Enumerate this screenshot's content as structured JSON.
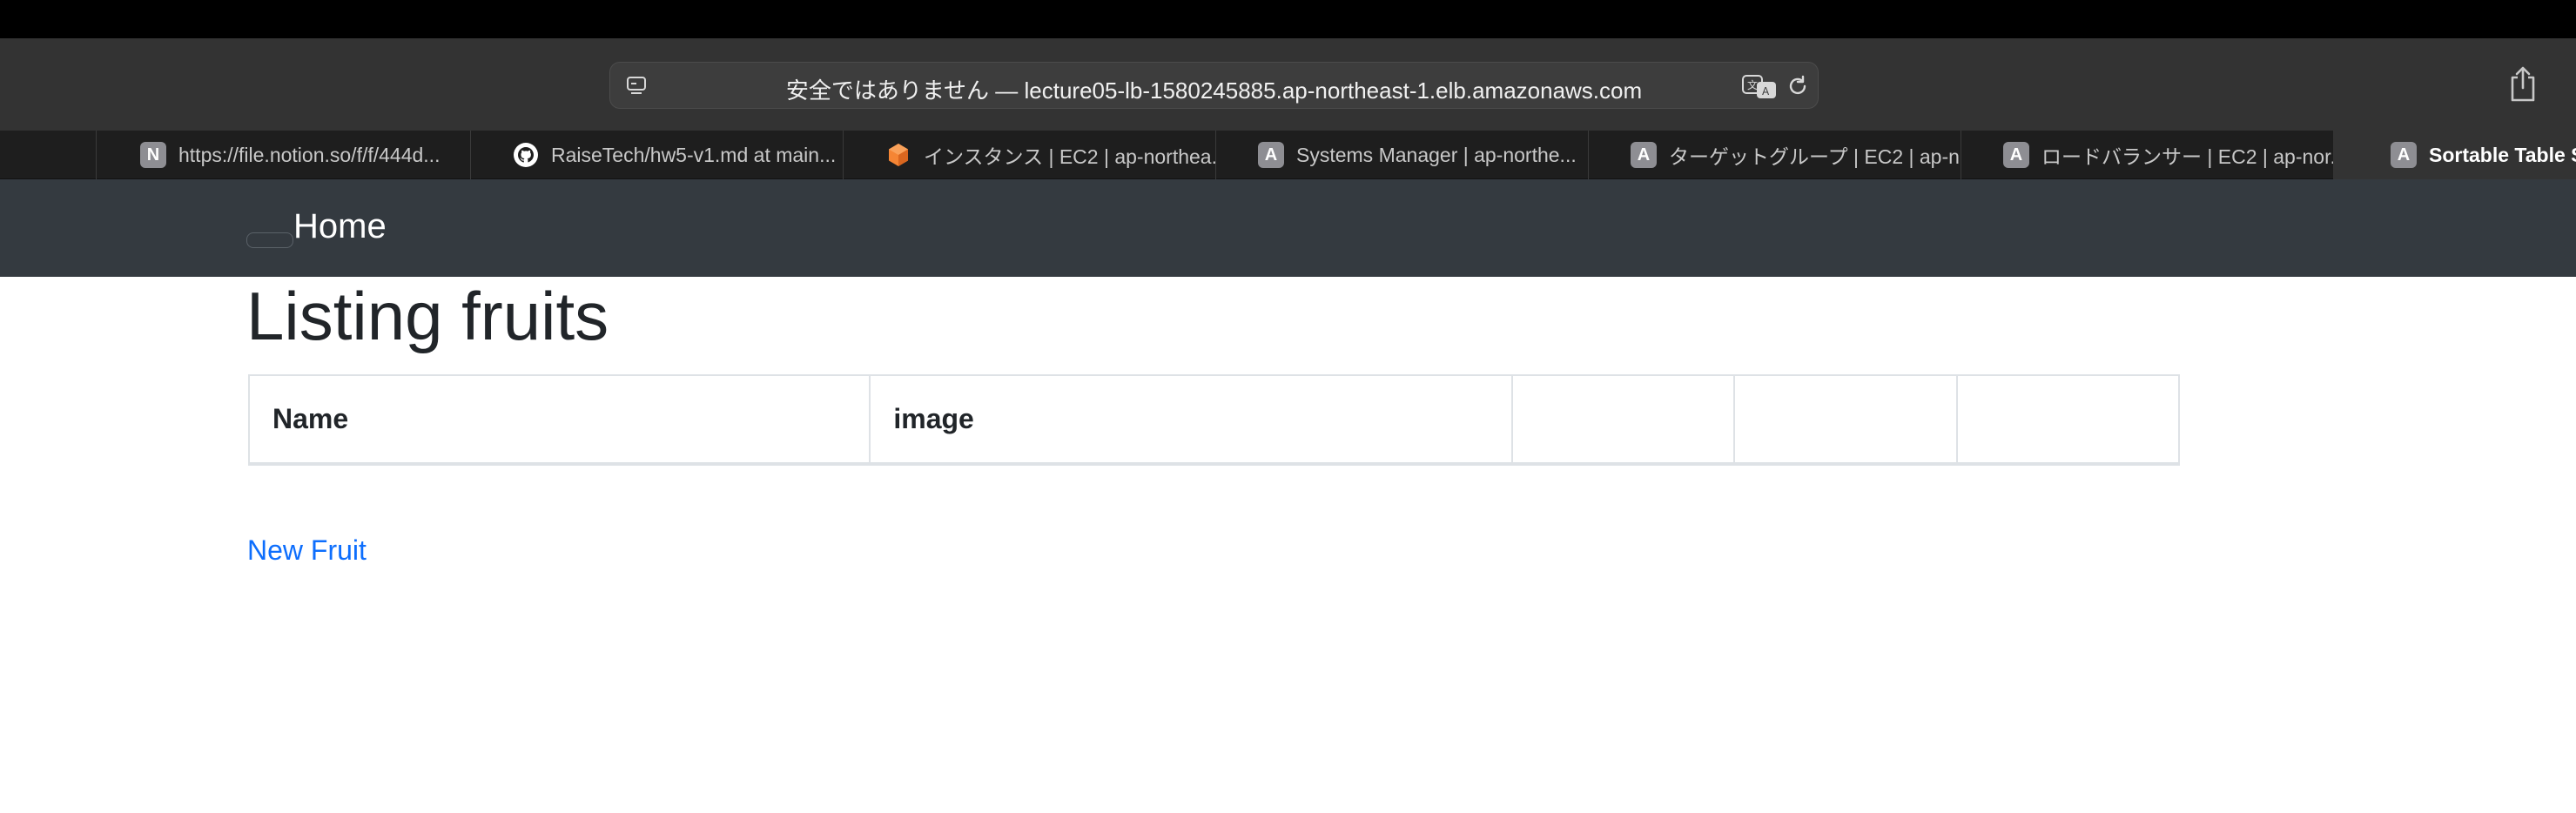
{
  "browser": {
    "address": "安全ではありません — lecture05-lb-1580245885.ap-northeast-1.elb.amazonaws.com",
    "icons": {
      "reader": "reader-icon",
      "translate": "translate-icon",
      "reload": "reload-icon",
      "share": "share-icon"
    }
  },
  "tabs": [
    {
      "label": "https://file.notion.so/f/f/444d...",
      "icon": "notion-icon",
      "favicon_text": "N"
    },
    {
      "label": "RaiseTech/hw5-v1.md at main...",
      "icon": "github-icon"
    },
    {
      "label": "インスタンス | EC2 | ap-northea...",
      "icon": "aws-ec2-icon"
    },
    {
      "label": "Systems Manager | ap-northe...",
      "icon": "generic-site-icon",
      "favicon_text": "A"
    },
    {
      "label": "ターゲットグループ | EC2 | ap-n...",
      "icon": "generic-site-icon",
      "favicon_text": "A"
    },
    {
      "label": "ロードバランサー | EC2 | ap-nor...",
      "icon": "generic-site-icon",
      "favicon_text": "A"
    },
    {
      "label": "Sortable Table S",
      "icon": "generic-site-icon",
      "favicon_text": "A"
    }
  ],
  "navbar": {
    "brand": "Home"
  },
  "main": {
    "title": "Listing fruits",
    "table": {
      "headers": [
        "Name",
        "image",
        "",
        "",
        ""
      ]
    },
    "new_link": "New Fruit"
  },
  "colors": {
    "navbar": "#343a40",
    "link": "#0d6efd",
    "toolbar": "#333333",
    "text": "#212529"
  }
}
